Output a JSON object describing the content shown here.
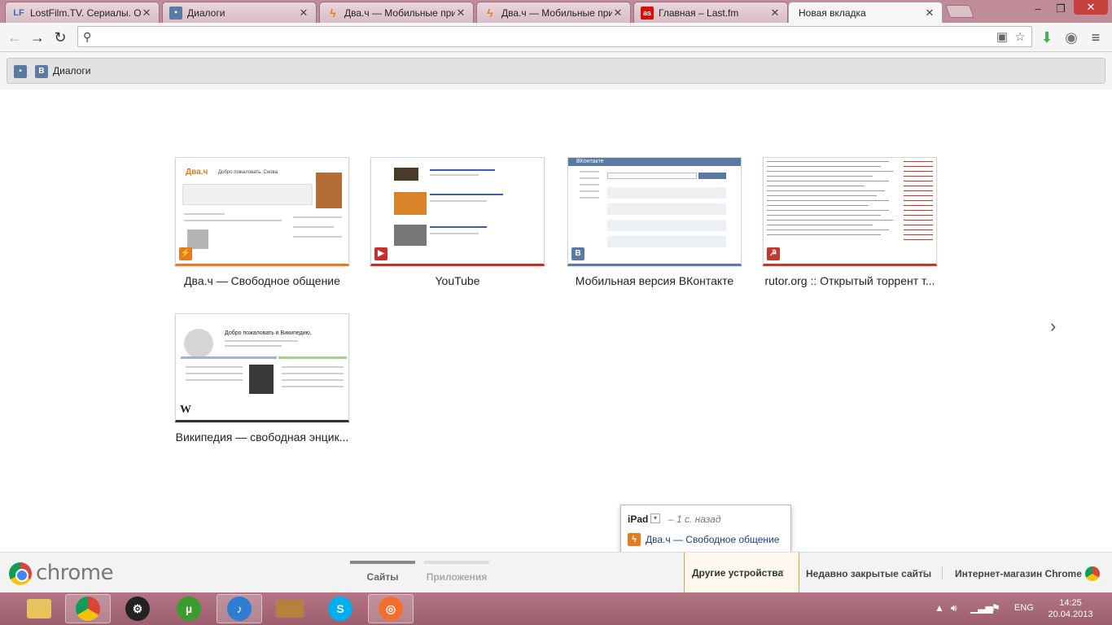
{
  "tabs": [
    {
      "title": "LostFilm.TV. Сериалы. Ос",
      "favicon": "LF"
    },
    {
      "title": "Диалоги",
      "favicon": "chat-icon"
    },
    {
      "title": "Два.ч — Мобильные при",
      "favicon": "lightning-icon"
    },
    {
      "title": "Два.ч — Мобильные при",
      "favicon": "lightning-icon"
    },
    {
      "title": "Главная – Last.fm",
      "favicon": "lastfm-icon"
    },
    {
      "title": "Новая вкладка",
      "favicon": ""
    }
  ],
  "omnibox": {
    "value": "",
    "placeholder": ""
  },
  "bookmarks": {
    "label": "Диалоги"
  },
  "tiles": [
    {
      "title": "Два.ч — Свободное общение",
      "fav": "⚡",
      "accent": "#e87b1f",
      "header": "Два.ч",
      "greeting": "Добро пожаловать. Снова."
    },
    {
      "title": "YouTube",
      "fav": "▶",
      "accent": "#c4302b"
    },
    {
      "title": "Мобильная версия ВКонтакте",
      "fav": "В",
      "accent": "#5b7aa3",
      "header": "ВКонтакте"
    },
    {
      "title": "rutor.org :: Открытый торрент т...",
      "fav": "☭",
      "accent": "#c0392b"
    },
    {
      "title": "Википедия — свободная энцик...",
      "fav": "W",
      "accent": "#333333",
      "greeting": "Добро пожаловать в Википедию,"
    }
  ],
  "popup": {
    "device": "iPad",
    "ago": "– 1 с. назад",
    "link": "Два.ч — Свободное общение"
  },
  "footer": {
    "brand": "chrome",
    "pager_sites": "Сайты",
    "pager_apps": "Приложения",
    "other_devices": "Другие устройства",
    "recently_closed": "Недавно закрытые сайты",
    "webstore": "Интернет-магазин Chrome"
  },
  "taskbar": {
    "apps": [
      "explorer-icon",
      "chrome-icon",
      "steam-icon",
      "utorrent-icon",
      "itunes-icon",
      "bioshock-icon",
      "skype-icon",
      "origin-icon"
    ],
    "lang": "ENG",
    "time": "14:25",
    "date": "20.04.2013"
  },
  "colors": {
    "lostfilm": "#3b6fb6",
    "vk": "#5b7aa3",
    "lastfm": "#d51007",
    "dvach": "#e87b1f",
    "youtube": "#c4302b"
  }
}
